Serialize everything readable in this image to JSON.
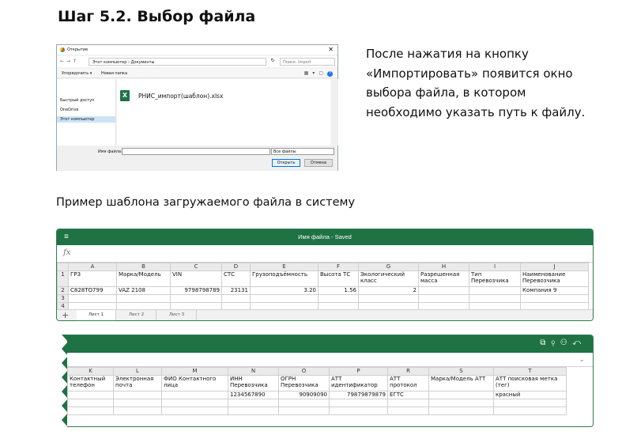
{
  "heading": "Шаг 5.2. Выбор файла",
  "dialog": {
    "title": "Открытие",
    "path": "Этот компьютер › Документы",
    "search_placeholder": "Поиск: Import",
    "organize": "Упорядочить ▾",
    "new_folder": "Новая папка",
    "sidebar": [
      "Быстрый доступ",
      "OneDrive",
      "Этот компьютер"
    ],
    "file": "РНИС_импорт(шаблон).xlsx",
    "filename_label": "Имя файла:",
    "filetype": "Все файлы",
    "open": "Открыть",
    "cancel": "Отмена"
  },
  "description": "После нажатия на кнопку «Импортировать» появится окно выбора файла, в котором необходимо указать путь к файлу.",
  "subtitle": "Пример шаблона загружаемого файла в систему",
  "sheet1": {
    "title": "Имя файла - Saved",
    "fx": "fx",
    "columns": [
      "A",
      "B",
      "C",
      "D",
      "E",
      "F",
      "G",
      "H",
      "I",
      "J"
    ],
    "rows": [
      [
        "ГРЗ",
        "Марка/Модель",
        "VIN",
        "СТС",
        "Грузоподъёмность",
        "Высота ТС",
        "Экологический класс",
        "Разрешенная масса",
        "Тип Перевозчика",
        "Наименование Перевозчика"
      ],
      [
        "С828ТО799",
        "VAZ 2108",
        "9798798789",
        "23131",
        "3.20",
        "1.56",
        "2",
        "",
        "",
        "Компания 9"
      ],
      [
        "",
        "",
        "",
        "",
        "",
        "",
        "",
        "",
        "",
        ""
      ],
      [
        "",
        "",
        "",
        "",
        "",
        "",
        "",
        "",
        "",
        ""
      ]
    ],
    "row_numbers": [
      "1",
      "2",
      "3",
      "4"
    ],
    "tabs": [
      "Лист 1",
      "Лист 2",
      "Лист 3"
    ]
  },
  "sheet2": {
    "columns": [
      "K",
      "L",
      "M",
      "N",
      "O",
      "P",
      "R",
      "S",
      "T"
    ],
    "rows": [
      [
        "Контактный телефон",
        "Электронная почта",
        "ФИО Контактного лица",
        "ИНН Перевозчика",
        "ОГРН Перевозчика",
        "АТТ идентификатор",
        "АТТ протокол",
        "Марка/Модель АТТ",
        "АТТ поисковая метка (тег)"
      ],
      [
        "",
        "",
        "",
        "1234567890",
        "90909090",
        "79879879879",
        "ЕГТС",
        "",
        "красный"
      ],
      [
        "",
        "",
        "",
        "",
        "",
        "",
        "",
        "",
        ""
      ],
      [
        "",
        "",
        "",
        "",
        "",
        "",
        "",
        "",
        ""
      ]
    ]
  },
  "colors": {
    "excel_green": "#1f7244",
    "header_gray": "#eaeaea"
  }
}
